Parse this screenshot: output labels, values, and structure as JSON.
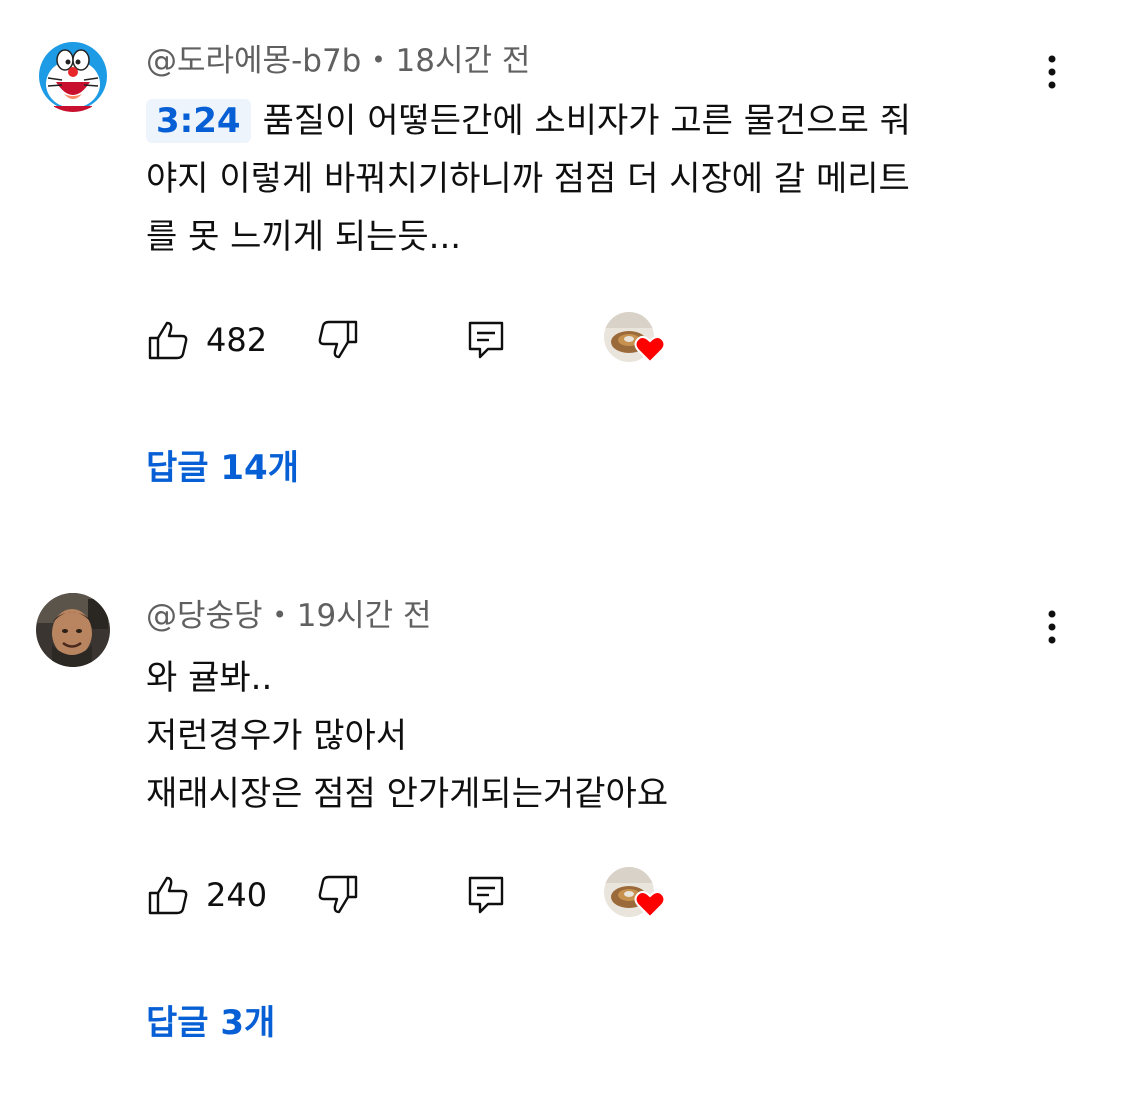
{
  "comments": [
    {
      "author": "@도라에몽-b7b",
      "time": "18시간 전",
      "timestamp": "3:24",
      "lines": [
        "품질이 어떻든간에 소비자가 고른 물건으로 줘",
        "야지 이렇게 바꿔치기하니까 점점 더 시장에 갈 메리트",
        "를 못 느끼게 되는듯..."
      ],
      "likes": "482",
      "replies": "답글 14개",
      "avatar_icon": "doraemon-avatar",
      "creator_hearted": true
    },
    {
      "author": "@당숭당",
      "time": "19시간 전",
      "lines": [
        "와 귤봐..",
        "저런경우가 많아서",
        "재래시장은 점점 안가게되는거같아요"
      ],
      "likes": "240",
      "replies": "답글 3개",
      "avatar_icon": "person-photo-avatar",
      "creator_hearted": true
    }
  ],
  "colors": {
    "text": "#0f0f0f",
    "meta": "#606060",
    "link": "#065fd4",
    "heart": "#ff0000"
  },
  "meta_separator": "•"
}
